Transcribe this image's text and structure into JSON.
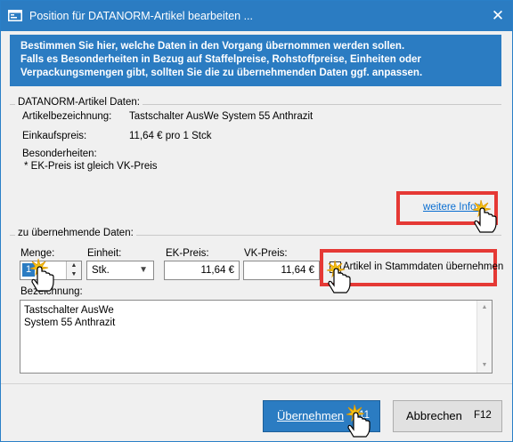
{
  "window": {
    "title": "Position für DATANORM-Artikel bearbeiten ..."
  },
  "info": {
    "line1": "Bestimmen Sie hier, welche Daten in den Vorgang übernommen werden sollen.",
    "line2": "Falls es Besonderheiten in Bezug auf Staffelpreise, Rohstoffpreise, Einheiten oder",
    "line3": "Verpackungsmengen gibt, sollten Sie die zu übernehmenden Daten ggf. anpassen."
  },
  "article": {
    "legend": "DATANORM-Artikel Daten:",
    "desc_label": "Artikelbezeichnung:",
    "desc_value": "Tastschalter AusWe System 55 Anthrazit",
    "price_label": "Einkaufspreis:",
    "price_value": "11,64 € pro 1 Stck",
    "special_label": "Besonderheiten:",
    "special_value": "* EK-Preis ist gleich VK-Preis",
    "more_link": "weitere Infos"
  },
  "transfer": {
    "legend": "zu übernehmende Daten:",
    "qty_label": "Menge:",
    "qty_value": "1",
    "unit_label": "Einheit:",
    "unit_value": "Stk.",
    "ek_label": "EK-Preis:",
    "ek_value": "11,64 €",
    "vk_label": "VK-Preis:",
    "vk_value": "11,64 €",
    "master_checkbox_label": "Artikel in Stammdaten übernehmen",
    "master_checked": false,
    "desc_label": "Bezeichnung:",
    "desc_line1": "Tastschalter AusWe",
    "desc_line2": "System 55 Anthrazit"
  },
  "buttons": {
    "ok_label": "Übernehmen",
    "ok_hotkey": "F11",
    "cancel_label": "Abbrechen",
    "cancel_hotkey": "F12"
  },
  "colors": {
    "accent": "#2b7cc2",
    "highlight": "#e53935",
    "link": "#0a6ed1"
  },
  "icons": {
    "window": "app-window-icon",
    "close": "close-icon",
    "cursor": "hand-pointer-icon"
  }
}
